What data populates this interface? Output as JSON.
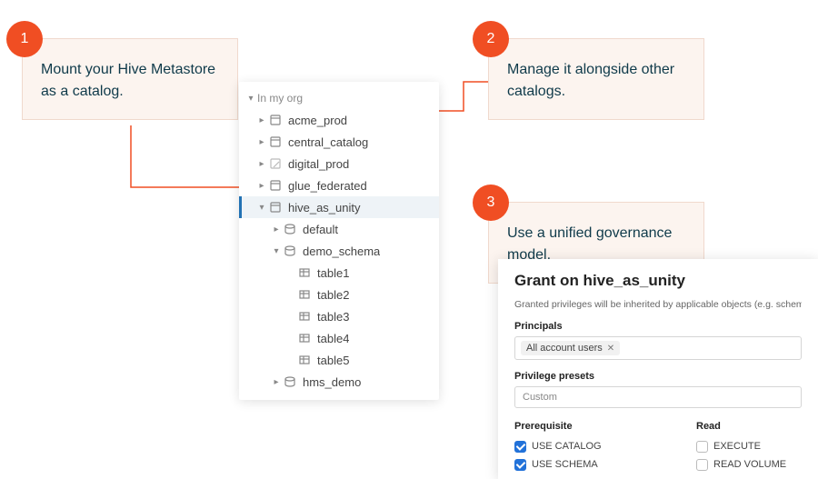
{
  "callouts": {
    "one": {
      "num": "1",
      "text": "Mount your Hive Metastore as a catalog."
    },
    "two": {
      "num": "2",
      "text": "Manage it alongside other catalogs."
    },
    "three": {
      "num": "3",
      "text": "Use a unified governance model."
    }
  },
  "tree": {
    "root_label": "In my org",
    "items": {
      "acme_prod": "acme_prod",
      "central_catalog": "central_catalog",
      "digital_prod": "digital_prod",
      "glue_federated": "glue_federated",
      "hive_as_unity": "hive_as_unity",
      "default": "default",
      "demo_schema": "demo_schema",
      "table1": "table1",
      "table2": "table2",
      "table3": "table3",
      "table4": "table4",
      "table5": "table5",
      "hms_demo": "hms_demo"
    }
  },
  "grant": {
    "title": "Grant on hive_as_unity",
    "subtitle": "Granted privileges will be inherited by applicable objects (e.g. schema",
    "principals_label": "Principals",
    "principal_chip": "All account users",
    "presets_label": "Privilege presets",
    "preset_value": "Custom",
    "col_prereq": "Prerequisite",
    "col_read": "Read",
    "use_catalog": "USE CATALOG",
    "use_schema": "USE SCHEMA",
    "execute": "EXECUTE",
    "read_volume": "READ VOLUME"
  }
}
